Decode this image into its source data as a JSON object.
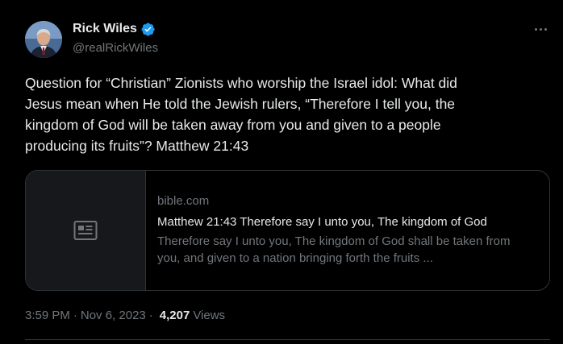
{
  "author": {
    "display_name": "Rick Wiles",
    "handle": "@realRickWiles",
    "verified": true
  },
  "tweet": {
    "text": "Question for “Christian” Zionists who worship the Israel idol: What did\nJesus mean when He told the Jewish rulers, “Therefore I tell you, the\nkingdom of God will be taken away from you and given to a people\nproducing its fruits”?   Matthew 21:43"
  },
  "card": {
    "domain": "bible.com",
    "title": "Matthew 21:43 Therefore say I unto you, The kingdom of God",
    "description": "Therefore say I unto you, The kingdom of God shall be taken from you, and given to a nation bringing forth the fruits ..."
  },
  "meta": {
    "time": "3:59 PM",
    "separator": "·",
    "date": "Nov 6, 2023",
    "views_count": "4,207",
    "views_label": "Views"
  },
  "colors": {
    "background": "#000000",
    "text_primary": "#e7e9ea",
    "text_secondary": "#71767b",
    "verified_blue": "#1d9bf0",
    "border": "#2f3336"
  },
  "icons": {
    "more": "more-horizontal-icon",
    "verified": "verified-badge-icon",
    "card_placeholder": "news-article-icon"
  }
}
